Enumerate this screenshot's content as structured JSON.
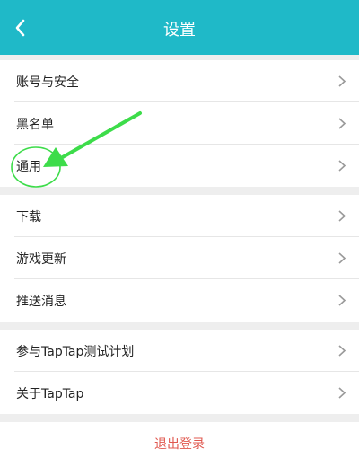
{
  "header": {
    "title": "设置",
    "back_icon": "chevron-left-icon",
    "bg_color": "#1fb9c8"
  },
  "groups": [
    {
      "items": [
        {
          "label": "账号与安全"
        },
        {
          "label": "黑名单"
        },
        {
          "label": "通用"
        }
      ]
    },
    {
      "items": [
        {
          "label": "下载"
        },
        {
          "label": "游戏更新"
        },
        {
          "label": "推送消息"
        }
      ]
    },
    {
      "items": [
        {
          "label": "参与TapTap测试计划"
        },
        {
          "label": "关于TapTap"
        }
      ]
    }
  ],
  "item_icon": "chevron-right-icon",
  "logout": {
    "label": "退出登录",
    "color": "#e0584f"
  },
  "annotation": {
    "arrow_color": "#3ddc4a",
    "circle_target": "通用"
  }
}
